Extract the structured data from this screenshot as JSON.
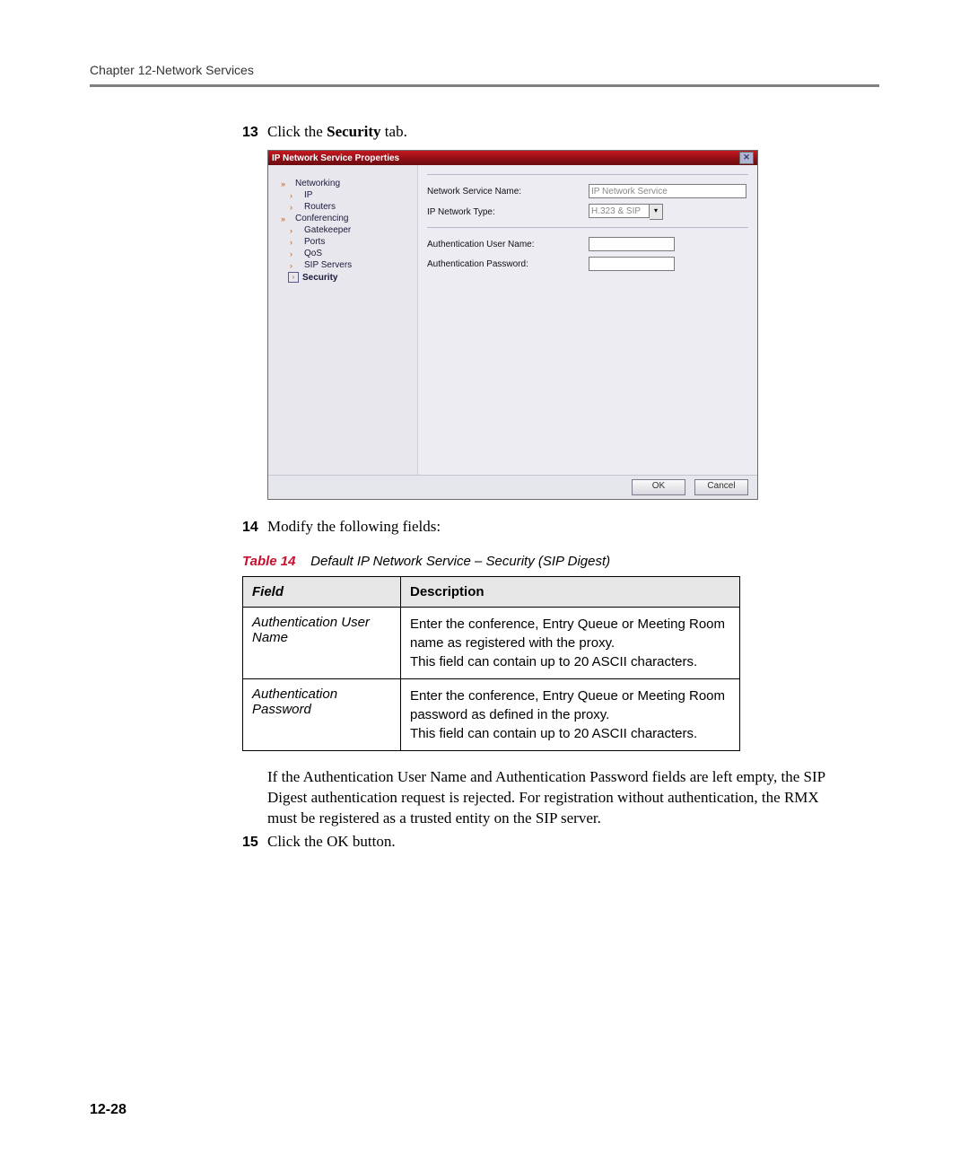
{
  "header": "Chapter 12-Network Services",
  "step13": {
    "num": "13",
    "pre": "Click the ",
    "bold": "Security",
    "post": " tab."
  },
  "step14": {
    "num": "14",
    "text": "Modify the following fields:"
  },
  "step15": {
    "num": "15",
    "text": "Click the OK button."
  },
  "paragraph_pre": "If the ",
  "paragraph_i1": "Authentication User Name",
  "paragraph_mid1": " and ",
  "paragraph_i2": "Authentication Password",
  "paragraph_post": " fields are left empty, the SIP Digest authentication request is rejected. For registration without authentication, the RMX must be registered as a trusted entity on the SIP server.",
  "page_num": "12-28",
  "dialog": {
    "title": "IP Network Service Properties",
    "sidebar": [
      {
        "label": "Networking",
        "type": "top"
      },
      {
        "label": "IP",
        "type": "sub"
      },
      {
        "label": "Routers",
        "type": "sub"
      },
      {
        "label": "Conferencing",
        "type": "top"
      },
      {
        "label": "Gatekeeper",
        "type": "sub"
      },
      {
        "label": "Ports",
        "type": "sub"
      },
      {
        "label": "QoS",
        "type": "sub"
      },
      {
        "label": "SIP Servers",
        "type": "sub"
      },
      {
        "label": "Security",
        "type": "sel"
      }
    ],
    "fields": {
      "svc_name_label": "Network Service Name:",
      "svc_name_value": "IP Network Service",
      "net_type_label": "IP Network Type:",
      "net_type_value": "H.323 & SIP",
      "auth_user_label": "Authentication User Name:",
      "auth_user_value": "",
      "auth_pass_label": "Authentication Password:",
      "auth_pass_value": ""
    },
    "ok": "OK",
    "cancel": "Cancel"
  },
  "table": {
    "caption_label": "Table 14",
    "caption_text": "Default IP Network Service – Security (SIP Digest)",
    "h1": "Field",
    "h2": "Description",
    "r1f": "Authentication User Name",
    "r1d1": "Enter the conference, Entry Queue or Meeting Room name as registered with the proxy.",
    "r1d2": "This field can contain up to 20 ASCII characters.",
    "r2f": "Authentication Password",
    "r2d1": "Enter the conference, Entry Queue or Meeting Room password as defined in the proxy.",
    "r2d2": "This field can contain up to 20 ASCII characters."
  }
}
